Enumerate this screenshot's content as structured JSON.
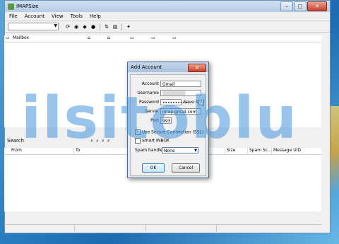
{
  "window": {
    "title": "IMAPSize",
    "controls": {
      "min": "–",
      "max": "□",
      "close": "✕"
    }
  },
  "menu": [
    "File",
    "Account",
    "View",
    "Tools",
    "Help"
  ],
  "mailbox": {
    "header": "Mailbox"
  },
  "search": {
    "label": "Search"
  },
  "message_columns": [
    "From",
    "To",
    "Size",
    "Spam Sc...",
    "Message UID"
  ],
  "dialog": {
    "title": "Add Account",
    "close": "✕",
    "account_label": "Account",
    "account_value": "Gmail",
    "username_label": "Username",
    "username_value": "▒▒▒▒▒▒▒",
    "password_label": "Password",
    "password_value": "••••••••••",
    "save_it_label": "Save it",
    "server_label": "Server",
    "server_value": "imap.gmail.com",
    "port_label": "Port",
    "port_value": "993",
    "ssl_label": "Use Secure Connection (SSL)",
    "smart_inbox_label": "Smart INBOX",
    "spam_label": "Spam handle",
    "spam_value": "None",
    "ok_label": "OK",
    "cancel_label": "Cancel"
  },
  "watermark": "ilsitoblu"
}
